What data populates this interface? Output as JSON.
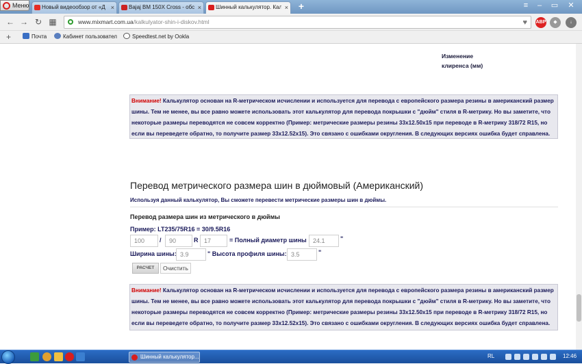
{
  "browser": {
    "menu_label": "Меню",
    "tabs": [
      {
        "title": "Новый видеообзор от «Д",
        "favicon_color": "#e52d27"
      },
      {
        "title": "Bajaj BM 150X Cross - обсу",
        "favicon_color": "#cc2222"
      },
      {
        "title": "Шинный калькулятор. Калк",
        "favicon_color": "#d81e1e"
      }
    ],
    "url_host": "www.mixmart.com.ua",
    "url_path": "/kalkulyator-shin-i-diskov.html",
    "ext_badge": "ABP",
    "bookmarks": [
      {
        "label": "Почта"
      },
      {
        "label": "Кабинет пользовател"
      },
      {
        "label": "Speedtest.net by Ookla"
      }
    ]
  },
  "page": {
    "clearance_label": "Изменение клиренса (мм)",
    "notice": {
      "warn": "Внимание!",
      "text": " Калькулятор основан на R-метрическом исчислении и используется для перевода с европейского размера резины в американский размер шины. Тем не менее, вы все равно можете использовать этот калькулятор для перевода покрышки с \"дюйм\" стиля в R-метрику. Но вы заметите, что некоторые размеры переводятся не совсем корректно (Пример: метрические размеры резины 33x12.50x15 при переводе в R-метрику 318/72 R15, но если вы переведете обратно, то получите размер 33x12.52x15). Это связано с ошибками округления. В следующих версиях ошибка будет справлена."
    },
    "section_title": "Перевод метрического размера шин в дюймовый (Американский)",
    "section_desc": "Используя данный калькулятор, Вы сможете перевести метрические размеры шин в дюймы.",
    "calc_title": "Перевод размера шин из метрического в дюймы",
    "calc_example": "Пример: LT235/75R16 = 30/9.5R16",
    "calc": {
      "width_value": "100",
      "slash": "/",
      "profile_value": "90",
      "r_label": "R",
      "rim_value": "17",
      "diameter_label": "= Полный диаметр шины",
      "diameter_value": "24.1",
      "inch_mark": "\"",
      "tire_width_label": "Ширина шины:",
      "tire_width_value": "3.9",
      "profile_height_label": "\" Высота профиля шины:",
      "profile_height_value": "3.5",
      "calc_button": "РАСЧЕТ",
      "clear_button": "Очистить"
    }
  },
  "taskbar": {
    "task_title": "Шинный калькулятор...",
    "lang": "RL",
    "clock": "12:46"
  },
  "colors": {
    "notice_bg": "#e8e8ee",
    "warn": "#d00000",
    "label": "#1a1a5a"
  }
}
